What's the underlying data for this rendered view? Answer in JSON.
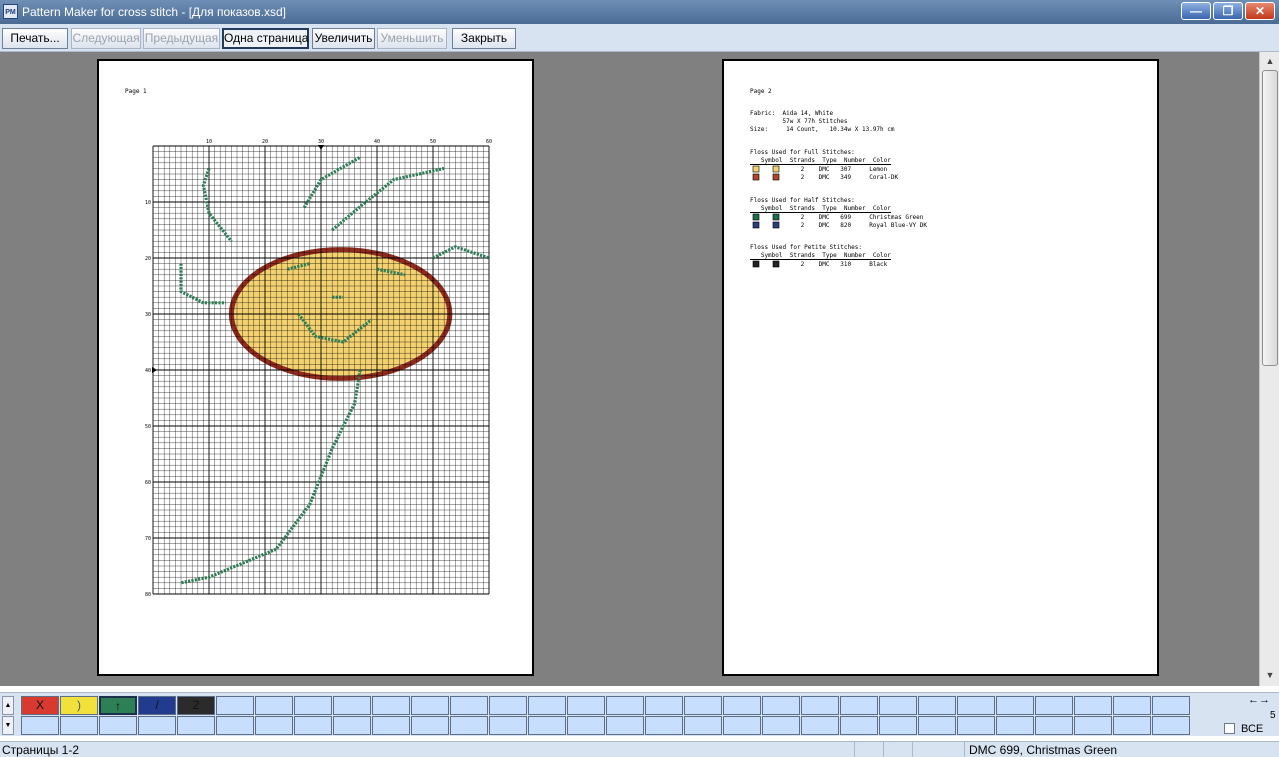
{
  "window": {
    "app_icon": "PM",
    "title": "Pattern Maker for cross stitch - [Для показов.xsd]"
  },
  "toolbar": {
    "print": "Печать...",
    "next": "Следующая",
    "previous": "Предыдущая",
    "one_page": "Одна страница",
    "zoom_in": "Увеличить",
    "zoom_out": "Уменьшить",
    "close": "Закрыть"
  },
  "page1": {
    "label": "Page 1",
    "cols_labels": [
      "10",
      "20",
      "30",
      "40",
      "50",
      "60"
    ],
    "rows_labels": [
      "10",
      "20",
      "30",
      "40",
      "50",
      "60",
      "70",
      "80"
    ],
    "colors": {
      "grid": "#000000",
      "fill": "#f4d270",
      "outline": "#8e2a1e",
      "stem": "#2f7d57"
    }
  },
  "page2": {
    "label": "Page 2",
    "fabric_line": "Fabric:  Aida 14, White",
    "stitches_line": "         57w X 77h Stitches",
    "size_line": "Size:     14 Count,   10.34w X 13.97h cm",
    "full_title": "Floss Used for Full Stitches:",
    "full_header": "   Symbol  Strands  Type  Number  Color",
    "full_rows": [
      "              2    DMC   307     Lemon",
      "              2    DMC   349     Coral-DK"
    ],
    "half_title": "Floss Used for Half Stitches:",
    "half_header": "   Symbol  Strands  Type  Number  Color",
    "half_rows": [
      "              2    DMC   699     Christmas Green",
      "              2    DMC   820     Royal Blue-VY DK"
    ],
    "petite_title": "Floss Used for Petite Stitches:",
    "petite_header": "   Symbol  Strands  Type  Number  Color",
    "petite_rows": [
      "              2    DMC   310     Black"
    ],
    "swatch_colors": [
      "#f4d270",
      "#b2452e",
      "#1f6d4c",
      "#2a3f7a",
      "#222222"
    ]
  },
  "palette": {
    "count": "5",
    "all_label": "ВСЕ",
    "arrows": "←→",
    "swatches": [
      {
        "symbol": "X",
        "color": "#d83a2f",
        "icon": "cross-stitch-icon"
      },
      {
        "symbol": ")",
        "color": "#f2e13a",
        "icon": "paren-icon"
      },
      {
        "symbol": "↑",
        "color": "#2d7f56",
        "icon": "arrow-up-icon"
      },
      {
        "symbol": "/",
        "color": "#233b8f",
        "icon": "slash-icon"
      },
      {
        "symbol": "2",
        "color": "#2b2b2b",
        "icon": "digit-two-icon"
      }
    ]
  },
  "status": {
    "pages": "Страницы 1-2",
    "floss": "DMC  699, Christmas Green"
  }
}
